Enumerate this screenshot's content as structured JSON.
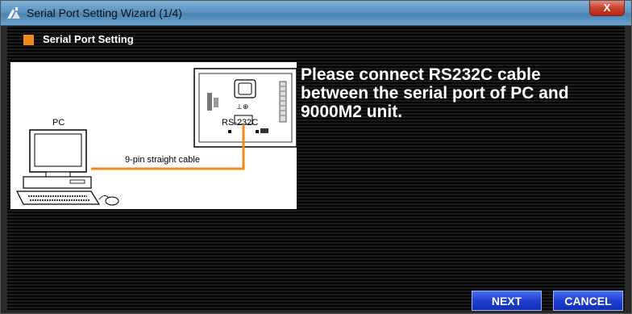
{
  "window": {
    "title": "Serial Port Setting Wizard (1/4)",
    "close_label": "X"
  },
  "section": {
    "title": "Serial Port Setting"
  },
  "illustration": {
    "pc_label": "PC",
    "port_label": "RS-232C",
    "cable_label": "9-pin straight cable"
  },
  "message": {
    "line1": "Please connect RS232C cable",
    "line2": "between the serial port of PC and",
    "line3": "9000M2 unit."
  },
  "buttons": {
    "next": "NEXT",
    "cancel": "CANCEL"
  },
  "colors": {
    "accent": "#f08a1c",
    "button": "#1f3fd0",
    "cable": "#f08a1c"
  }
}
